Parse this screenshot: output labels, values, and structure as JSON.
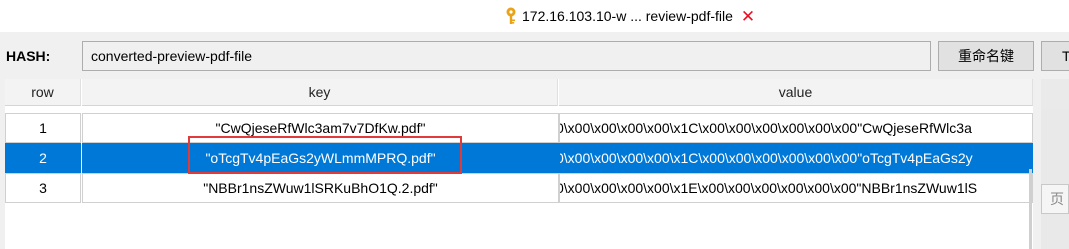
{
  "window": {
    "title": "172.16.103.10-w ... review-pdf-file",
    "key_icon": "key-icon",
    "close_icon": "close-icon",
    "close_glyph": "✕"
  },
  "hash": {
    "label": "HASH:",
    "value": "converted-preview-pdf-file"
  },
  "toolbar": {
    "rename_label": "重命名键",
    "ttl_label": "T"
  },
  "table": {
    "columns": [
      "row",
      "key",
      "value"
    ],
    "rows": [
      {
        "row": "1",
        "key": "\"CwQjeseRfWlc3am7v7DfKw.pdf\"",
        "value": "0\\x00\\x00\\x00\\x00\\x1C\\x00\\x00\\x00\\x00\\x00\\x00\"CwQjeseRfWlc3a",
        "selected": false
      },
      {
        "row": "2",
        "key": "\"oTcgTv4pEaGs2yWLmmMPRQ.pdf\"",
        "value": "0\\x00\\x00\\x00\\x00\\x1C\\x00\\x00\\x00\\x00\\x00\\x00\"oTcgTv4pEaGs2y",
        "selected": true
      },
      {
        "row": "3",
        "key": "\"NBBr1nsZWuw1lSRKuBhO1Q.2.pdf\"",
        "value": "0\\x00\\x00\\x00\\x00\\x1E\\x00\\x00\\x00\\x00\\x00\\x00\"NBBr1nsZWuw1lS",
        "selected": false
      }
    ]
  },
  "side": {
    "page_label": "页"
  },
  "colors": {
    "selection": "#0078d7",
    "highlight": "#e03a3a",
    "close": "#e81123",
    "key_icon": "#e8a317"
  }
}
